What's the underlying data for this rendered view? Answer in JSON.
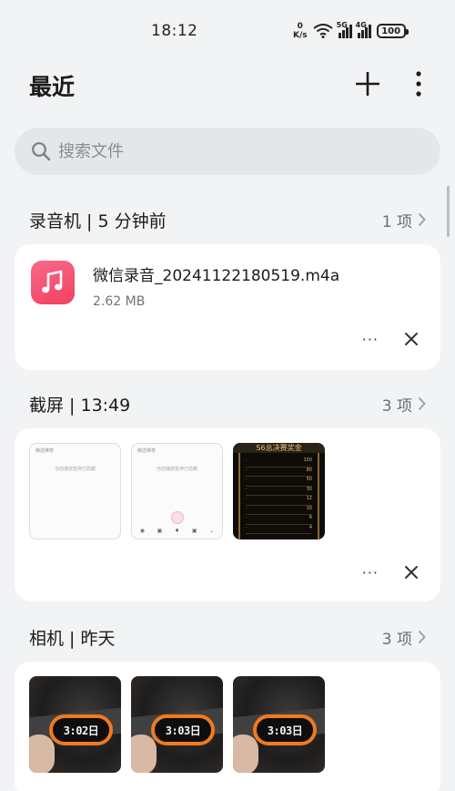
{
  "status_bar": {
    "time": "18:12",
    "net_speed_value": "0",
    "net_speed_unit": "K/s",
    "sim1_label": "5G",
    "sim2_label": "4G",
    "battery": "100"
  },
  "header": {
    "title": "最近"
  },
  "search": {
    "placeholder": "搜索文件"
  },
  "sections": [
    {
      "title": "录音机 | 5 分钟前",
      "count": "1 项",
      "files": [
        {
          "name": "微信录音_20241122180519.m4a",
          "size": "2.62 MB"
        }
      ],
      "more_label": "···"
    },
    {
      "title": "截屏 | 13:49",
      "count": "3 项",
      "more_label": "···",
      "thumb_texts": {
        "screenshot_header": "精选推荐",
        "screenshot_body": "当前播放暂停已隐藏",
        "dark_title": "S6总决赛奖金",
        "dark_values": [
          "150",
          "80",
          "50",
          "30",
          "12",
          "10",
          "6",
          "4"
        ]
      }
    },
    {
      "title": "相机 | 昨天",
      "count": "3 项",
      "photo_readings": [
        "3:02日",
        "3:03日",
        "3:03日"
      ]
    }
  ],
  "icons": {
    "search": "search-icon",
    "add": "plus-icon",
    "more": "more-vertical-icon",
    "chevron": "chevron-right-icon",
    "close": "close-icon",
    "music": "music-note-icon"
  },
  "colors": {
    "background": "#f1f3f5",
    "card": "#ffffff",
    "music_gradient_start": "#f76a8b",
    "music_gradient_end": "#f2415f",
    "accent_orange": "#f07a1e"
  }
}
